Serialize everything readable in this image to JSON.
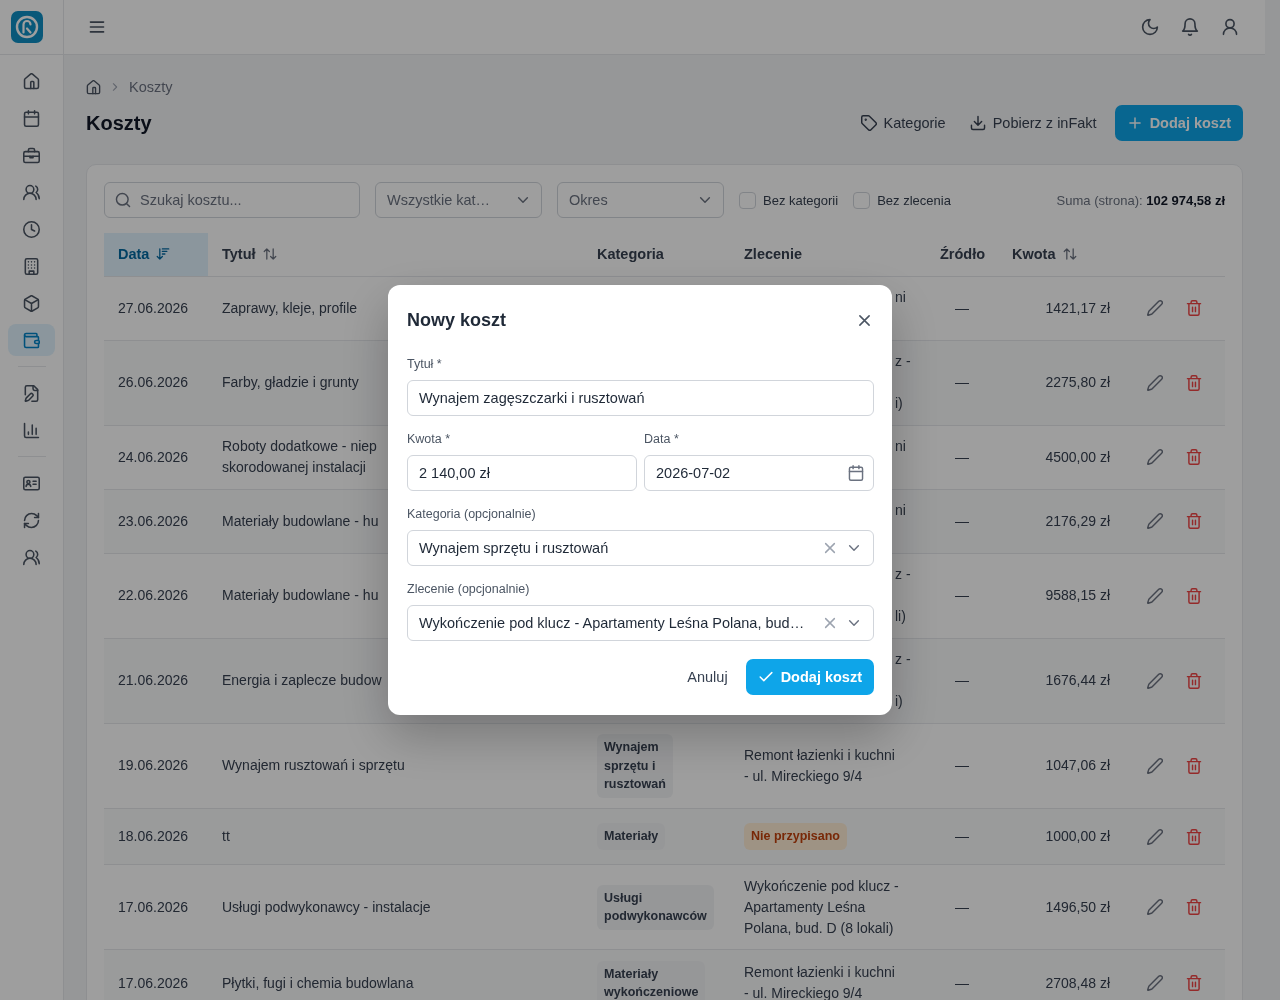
{
  "sidebar": {
    "groups": [
      {
        "items": [
          {
            "selected": false
          },
          {
            "selected": false
          },
          {
            "selected": false
          },
          {
            "selected": false
          },
          {
            "selected": false
          },
          {
            "selected": false
          },
          {
            "selected": false
          },
          {
            "selected": true
          }
        ]
      },
      {
        "items": [
          {
            "selected": false
          },
          {
            "selected": false
          }
        ]
      },
      {
        "items": [
          {
            "selected": false
          },
          {
            "selected": false
          },
          {
            "selected": false
          }
        ]
      }
    ]
  },
  "breadcrumb": {
    "items": [
      "Koszty"
    ]
  },
  "page_header": {
    "title": "Koszty",
    "actions": [
      {
        "label": "Kategorie",
        "kind": "ghost"
      },
      {
        "label": "Pobierz z inFakt",
        "kind": "ghost"
      },
      {
        "label": "Dodaj koszt",
        "kind": "primary"
      }
    ]
  },
  "filters": {
    "search": {
      "placeholder": "Szukaj kosztu..."
    },
    "selects": [
      {
        "placeholder": "Wszystkie kat…"
      },
      {
        "placeholder": "Okres"
      }
    ],
    "checkboxes": [
      {
        "label": "Bez kategorii",
        "checked": false
      },
      {
        "label": "Bez zlecenia",
        "checked": false
      }
    ],
    "sum": "Suma (strona): **102 974,58 zł**"
  },
  "table": {
    "columns": [
      {
        "label": "Data",
        "sortable": true,
        "selected": true
      },
      {
        "label": "Tytuł",
        "sortable": true,
        "selected": false
      },
      {
        "label": "Kategoria",
        "sortable": false,
        "selected": false
      },
      {
        "label": "Zlecenie",
        "sortable": false,
        "selected": false
      },
      {
        "label": "Źródło",
        "sortable": false,
        "selected": false
      },
      {
        "label": "Kwota",
        "sortable": true,
        "selected": false
      }
    ],
    "rows": [
      {
        "date": "27.06.2026",
        "title": "Zaprawy, kleje, profile",
        "order_visible": [
          "ni"
        ],
        "source": "—",
        "amount": "1421,17 zł"
      },
      {
        "date": "26.06.2026",
        "title": "Farby, gładzie i grunty",
        "order_visible": [
          "z -",
          "i)"
        ],
        "source": "—",
        "amount": "2275,80 zł"
      },
      {
        "date": "24.06.2026",
        "title": "Roboty dodatkowe - niep\nskorodowanej instalacji",
        "order_visible": [
          "ni"
        ],
        "source": "—",
        "amount": "4500,00 zł"
      },
      {
        "date": "23.06.2026",
        "title": "Materiały budowlane - hu",
        "order_visible": [
          "ni"
        ],
        "source": "—",
        "amount": "2176,29 zł"
      },
      {
        "date": "22.06.2026",
        "title": "Materiały budowlane - hu",
        "order_visible": [
          "z -",
          "li)"
        ],
        "source": "—",
        "amount": "9588,15 zł"
      },
      {
        "date": "21.06.2026",
        "title": "Energia i zaplecze budow",
        "order_visible": [
          "z -",
          "i)"
        ],
        "source": "—",
        "amount": "1676,44 zł"
      },
      {
        "date": "19.06.2026",
        "title": "Wynajem rusztowań i sprzętu",
        "category": "Wynajem\nsprzętu i\nrusztowań",
        "order": "Remont łazienki i kuchni\n- ul. Mireckiego 9/4",
        "source": "—",
        "amount": "1047,06 zł"
      },
      {
        "date": "18.06.2026",
        "title": "tt",
        "category": "Materiały",
        "order_badge": "Nie przypisano",
        "source": "—",
        "amount": "1000,00 zł"
      },
      {
        "date": "17.06.2026",
        "title": "Usługi podwykonawcy - instalacje",
        "category": "Usługi\npodwykonawców",
        "order": "Wykończenie pod klucz -\nApartamenty Leśna\nPolana, bud. D (8 lokali)",
        "source": "—",
        "amount": "1496,50 zł"
      },
      {
        "date": "17.06.2026",
        "title": "Płytki, fugi i chemia budowlana",
        "category": "Materiały\nwykończeniowe",
        "order": "Remont łazienki i kuchni\n- ul. Mireckiego 9/4",
        "source": "—",
        "amount": "2708,48 zł"
      }
    ]
  },
  "dialog": {
    "title": "Nowy koszt",
    "rows": [
      {
        "fields": [
          {
            "label": "Tytuł *",
            "value": "Wynajem zagęszczarki i rusztowań",
            "kind": "text"
          }
        ]
      },
      {
        "fields": [
          {
            "label": "Kwota *",
            "value": "2 140,00 zł",
            "kind": "text"
          },
          {
            "label": "Data *",
            "value": "2026-07-02",
            "kind": "date"
          }
        ]
      },
      {
        "fields": [
          {
            "label": "Kategoria (opcjonalnie)",
            "value": "Wynajem sprzętu i rusztowań",
            "kind": "select"
          }
        ]
      },
      {
        "fields": [
          {
            "label": "Zlecenie (opcjonalnie)",
            "value": "Wykończenie pod klucz - Apartamenty Leśna Polana, bud…",
            "kind": "select"
          }
        ]
      }
    ],
    "buttons": [
      {
        "label": "Anuluj",
        "kind": "ghost"
      },
      {
        "label": "Dodaj koszt",
        "kind": "primary"
      }
    ]
  }
}
